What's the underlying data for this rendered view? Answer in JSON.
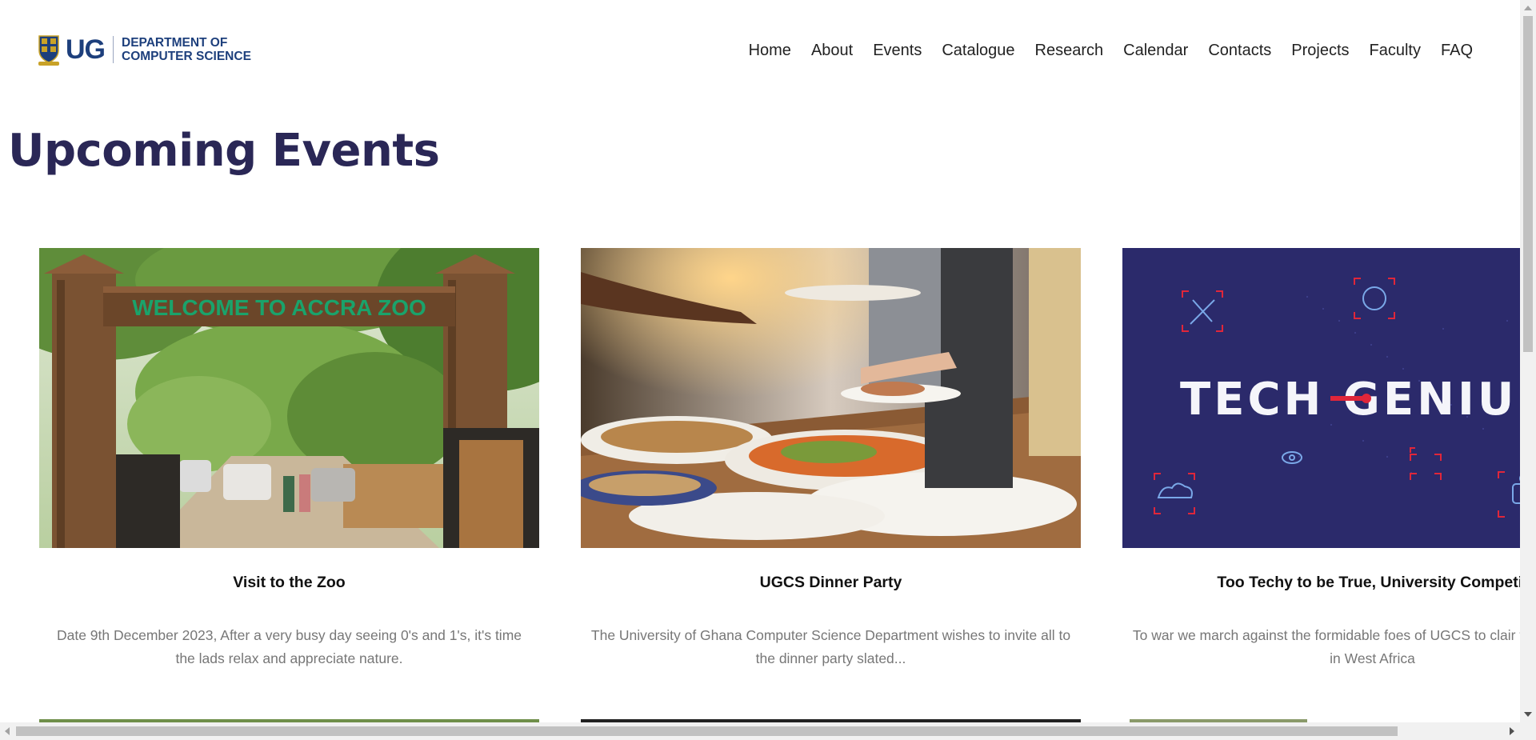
{
  "header": {
    "logo_abbr": "UG",
    "logo_line1": "DEPARTMENT OF",
    "logo_line2": "COMPUTER SCIENCE"
  },
  "nav": {
    "items": [
      "Home",
      "About",
      "Events",
      "Catalogue",
      "Research",
      "Calendar",
      "Contacts",
      "Projects",
      "Faculty",
      "FAQ"
    ]
  },
  "page": {
    "title": "Upcoming Events"
  },
  "events": [
    {
      "title": "Visit to the Zoo",
      "description": "Date 9th December 2023, After a very busy day seeing 0's and 1's, it's time the lads relax and appreciate nature.",
      "image_text": "WELCOME TO ACCRA ZOO"
    },
    {
      "title": "UGCS Dinner Party",
      "description": "The University of Ghana Computer Science Department wishes to invite all to the dinner party slated..."
    },
    {
      "title": "Too Techy to be True, University Competit",
      "description": "To war we march against the formidable foes of UGCS to clair techiest school in West Africa",
      "image_text": "TECH GENIU"
    }
  ],
  "colors": {
    "brand_navy": "#1d3f7c",
    "title_color": "#2a2756",
    "tech_bg": "#2b2a6b",
    "tech_red": "#e0263a"
  }
}
